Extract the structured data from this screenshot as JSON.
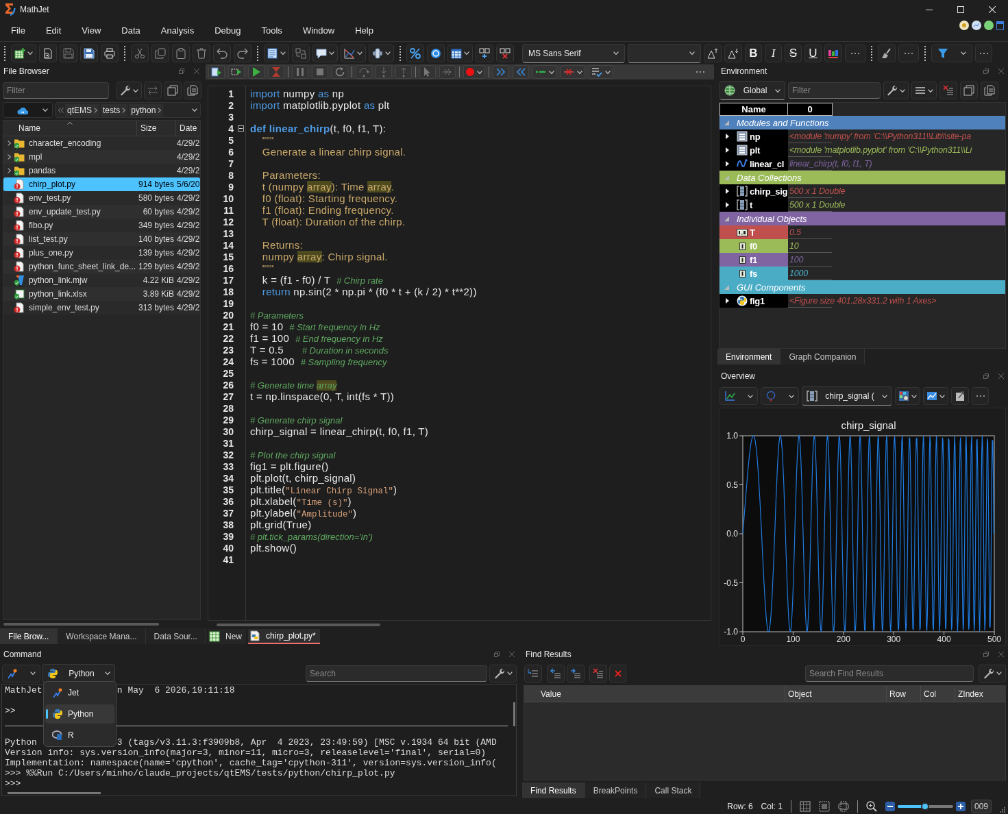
{
  "window": {
    "title": "MathJet"
  },
  "menu": [
    "File",
    "Edit",
    "View",
    "Data",
    "Analysis",
    "Debug",
    "Tools",
    "Window",
    "Help"
  ],
  "toolbar": {
    "font": "MS Sans Serif",
    "format_buttons": [
      {
        "label": "B",
        "kind": "bold"
      },
      {
        "label": "I",
        "kind": "italic"
      },
      {
        "label": "S",
        "kind": "strike"
      },
      {
        "label": "U",
        "kind": "underline"
      }
    ]
  },
  "file_browser": {
    "title": "File Browser",
    "filter": {
      "placeholder": "Filter"
    },
    "path": [
      "qtEMS",
      "tests",
      "python"
    ],
    "columns": [
      "Name",
      "Size",
      "Date"
    ],
    "files": [
      {
        "name": "character_encoding",
        "date": "4/29/2",
        "kind": "folder",
        "error": false,
        "selected": false
      },
      {
        "name": "mpl",
        "date": "4/29/2",
        "kind": "folder",
        "error": false,
        "selected": false
      },
      {
        "name": "pandas",
        "date": "4/29/2",
        "kind": "folder",
        "error": false,
        "selected": false
      },
      {
        "name": "chirp_plot.py",
        "size": "914 bytes",
        "date": "5/6/20",
        "kind": "python",
        "error": true,
        "selected": true
      },
      {
        "name": "env_test.py",
        "size": "580 bytes",
        "date": "4/29/2",
        "kind": "python",
        "error": true,
        "selected": false
      },
      {
        "name": "env_update_test.py",
        "size": "60 bytes",
        "date": "4/29/2",
        "kind": "python",
        "error": true,
        "selected": false
      },
      {
        "name": "fibo.py",
        "size": "349 bytes",
        "date": "4/29/2",
        "kind": "python",
        "error": true,
        "selected": false
      },
      {
        "name": "list_test.py",
        "size": "140 bytes",
        "date": "4/29/2",
        "kind": "python",
        "error": true,
        "selected": false
      },
      {
        "name": "plus_one.py",
        "size": "139 bytes",
        "date": "4/29/2",
        "kind": "python",
        "error": true,
        "selected": false
      },
      {
        "name": "python_func_sheet_link_de...",
        "size": "129 bytes",
        "date": "4/29/2",
        "kind": "python",
        "error": true,
        "selected": false
      },
      {
        "name": "python_link.mjw",
        "size": "4.22 KiB",
        "date": "4/29/2",
        "kind": "mathjet",
        "error": false,
        "selected": false
      },
      {
        "name": "python_link.xlsx",
        "size": "3.89 KiB",
        "date": "4/29/2",
        "kind": "excel",
        "error": false,
        "selected": false
      },
      {
        "name": "simple_env_test.py",
        "size": "313 bytes",
        "date": "4/29/2",
        "kind": "python",
        "error": true,
        "selected": false
      }
    ],
    "tabs": [
      {
        "label": "File Brow...",
        "selected": true
      },
      {
        "label": "Workspace Mana...",
        "selected": false
      },
      {
        "label": "Data Sour...",
        "selected": false
      }
    ]
  },
  "editor": {
    "lines": [
      {
        "number": "1",
        "fold": false,
        "segments": [
          {
            "kind": "keyword",
            "text": "import"
          },
          {
            "kind": "plain",
            "text": " numpy "
          },
          {
            "kind": "keyword",
            "text": "as"
          },
          {
            "kind": "plain",
            "text": " np"
          }
        ]
      },
      {
        "number": "2",
        "fold": false,
        "segments": [
          {
            "kind": "keyword",
            "text": "import"
          },
          {
            "kind": "plain",
            "text": " matplotlib.pyplot "
          },
          {
            "kind": "keyword",
            "text": "as"
          },
          {
            "kind": "plain",
            "text": " plt"
          }
        ]
      },
      {
        "number": "3",
        "fold": false
      },
      {
        "number": "4",
        "fold": true,
        "segments": [
          {
            "kind": "definition",
            "text": "def linear_chirp"
          },
          {
            "kind": "plain",
            "text": "(t, f0, f1, T):"
          }
        ]
      },
      {
        "number": "5",
        "fold": false,
        "segments": [
          {
            "kind": "docstring",
            "text": "    \"\"\""
          }
        ]
      },
      {
        "number": "6",
        "fold": false,
        "segments": [
          {
            "kind": "docstring",
            "text": "    Generate a linear chirp signal."
          }
        ]
      },
      {
        "number": "7",
        "fold": false
      },
      {
        "number": "8",
        "fold": false,
        "segments": [
          {
            "kind": "docstring",
            "text": "    Parameters:"
          }
        ]
      },
      {
        "number": "9",
        "fold": false,
        "segments": [
          {
            "kind": "docstring",
            "text": "    t (numpy "
          },
          {
            "kind": "docstring-match",
            "text": "array"
          },
          {
            "kind": "docstring",
            "text": "): Time "
          },
          {
            "kind": "docstring-match",
            "text": "array"
          },
          {
            "kind": "docstring",
            "text": "."
          }
        ]
      },
      {
        "number": "10",
        "fold": false,
        "segments": [
          {
            "kind": "docstring",
            "text": "    f0 (float): Starting frequency."
          }
        ]
      },
      {
        "number": "11",
        "fold": false,
        "segments": [
          {
            "kind": "docstring",
            "text": "    f1 (float): Ending frequency."
          }
        ]
      },
      {
        "number": "12",
        "fold": false,
        "segments": [
          {
            "kind": "docstring",
            "text": "    T (float): Duration of the chirp."
          }
        ]
      },
      {
        "number": "13",
        "fold": false
      },
      {
        "number": "14",
        "fold": false,
        "segments": [
          {
            "kind": "docstring",
            "text": "    Returns:"
          }
        ]
      },
      {
        "number": "15",
        "fold": false,
        "segments": [
          {
            "kind": "docstring",
            "text": "    numpy "
          },
          {
            "kind": "docstring-match",
            "text": "array"
          },
          {
            "kind": "docstring",
            "text": ": Chirp signal."
          }
        ]
      },
      {
        "number": "16",
        "fold": false,
        "segments": [
          {
            "kind": "docstring",
            "text": "    \"\"\""
          }
        ]
      },
      {
        "number": "17",
        "fold": false,
        "segments": [
          {
            "kind": "plain",
            "text": "    k = (f1 - f0) / T  "
          },
          {
            "kind": "comment",
            "text": "# Chirp rate"
          }
        ]
      },
      {
        "number": "18",
        "fold": false,
        "segments": [
          {
            "kind": "keyword",
            "text": "    return"
          },
          {
            "kind": "plain",
            "text": " np.sin(2 * np.pi * (f0 * t + (k / 2) * t**2))"
          }
        ]
      },
      {
        "number": "19",
        "fold": false
      },
      {
        "number": "20",
        "fold": false,
        "segments": [
          {
            "kind": "comment",
            "text": "# Parameters"
          }
        ]
      },
      {
        "number": "21",
        "fold": false,
        "segments": [
          {
            "kind": "plain",
            "text": "f0 = 10  "
          },
          {
            "kind": "comment",
            "text": "# Start frequency in Hz"
          }
        ]
      },
      {
        "number": "22",
        "fold": false,
        "segments": [
          {
            "kind": "plain",
            "text": "f1 = 100  "
          },
          {
            "kind": "comment",
            "text": "# End frequency in Hz"
          }
        ]
      },
      {
        "number": "23",
        "fold": false,
        "segments": [
          {
            "kind": "plain",
            "text": "T = 0.5      "
          },
          {
            "kind": "comment",
            "text": "# Duration in seconds"
          }
        ]
      },
      {
        "number": "24",
        "fold": false,
        "segments": [
          {
            "kind": "plain",
            "text": "fs = 1000  "
          },
          {
            "kind": "comment",
            "text": "# Sampling frequency"
          }
        ]
      },
      {
        "number": "25",
        "fold": false
      },
      {
        "number": "26",
        "fold": false,
        "segments": [
          {
            "kind": "comment",
            "text": "# Generate time "
          },
          {
            "kind": "comment-match",
            "text": "array"
          }
        ]
      },
      {
        "number": "27",
        "fold": false,
        "segments": [
          {
            "kind": "plain",
            "text": "t = np.linspace(0, T, int(fs * T))"
          }
        ]
      },
      {
        "number": "28",
        "fold": false
      },
      {
        "number": "29",
        "fold": false,
        "segments": [
          {
            "kind": "comment",
            "text": "# Generate chirp signal"
          }
        ]
      },
      {
        "number": "30",
        "fold": false,
        "segments": [
          {
            "kind": "plain",
            "text": "chirp_signal = linear_chirp(t, f0, f1, T)"
          }
        ]
      },
      {
        "number": "31",
        "fold": false
      },
      {
        "number": "32",
        "fold": false,
        "segments": [
          {
            "kind": "comment",
            "text": "# Plot the chirp signal"
          }
        ]
      },
      {
        "number": "33",
        "fold": false,
        "segments": [
          {
            "kind": "plain",
            "text": "fig1 = plt.figure()"
          }
        ]
      },
      {
        "number": "34",
        "fold": false,
        "segments": [
          {
            "kind": "plain",
            "text": "plt.plot(t, chirp_signal)"
          }
        ]
      },
      {
        "number": "35",
        "fold": false,
        "segments": [
          {
            "kind": "plain",
            "text": "plt.title("
          },
          {
            "kind": "string",
            "text": "\"Linear Chirp Signal\""
          },
          {
            "kind": "plain",
            "text": ")"
          }
        ]
      },
      {
        "number": "36",
        "fold": false,
        "segments": [
          {
            "kind": "plain",
            "text": "plt.xlabel("
          },
          {
            "kind": "string",
            "text": "\"Time (s)\""
          },
          {
            "kind": "plain",
            "text": ")"
          }
        ]
      },
      {
        "number": "37",
        "fold": false,
        "segments": [
          {
            "kind": "plain",
            "text": "plt.ylabel("
          },
          {
            "kind": "string",
            "text": "\"Amplitude\""
          },
          {
            "kind": "plain",
            "text": ")"
          }
        ]
      },
      {
        "number": "38",
        "fold": false,
        "segments": [
          {
            "kind": "plain",
            "text": "plt.grid(True)"
          }
        ]
      },
      {
        "number": "39",
        "fold": false,
        "segments": [
          {
            "kind": "comment",
            "text": "# plt.tick_params(direction='in')"
          }
        ]
      },
      {
        "number": "40",
        "fold": false,
        "segments": [
          {
            "kind": "plain",
            "text": "plt.show()"
          }
        ]
      },
      {
        "number": "41",
        "fold": false
      }
    ],
    "tabs": [
      {
        "label": "New",
        "kind": "sheet",
        "selected": false
      },
      {
        "label": "chirp_plot.py*",
        "kind": "python",
        "selected": true
      }
    ]
  },
  "environment": {
    "title": "Environment",
    "scope": "Global",
    "filter": {
      "placeholder": "Filter"
    },
    "columns": [
      "Name",
      "0"
    ],
    "groups": [
      {
        "label": "Modules and Functions",
        "color": "#4f81bd",
        "expanded": true,
        "items": [
          {
            "name": "np",
            "value": "<module 'numpy' from 'C:\\\\Python311\\\\Lib\\\\site-pa",
            "kind": "module",
            "color": "#c0504d",
            "highlighted": false,
            "expandable": true
          },
          {
            "name": "plt",
            "value": "<module 'matplotlib.pyplot' from 'C:\\\\Python311\\\\Li",
            "kind": "module",
            "color": "#9bbb59",
            "highlighted": false,
            "expandable": true
          },
          {
            "name": "linear_cl",
            "value": "linear_chirp(t, f0, f1, T)",
            "kind": "function",
            "color": "#8064a2",
            "highlighted": false,
            "expandable": true
          }
        ]
      },
      {
        "label": "Data Collections",
        "color": "#9bbb59",
        "expanded": true,
        "items": [
          {
            "name": "chirp_sig",
            "value": "500 x 1 Double",
            "kind": "array",
            "color": "#c0504d",
            "highlighted": false,
            "expandable": true
          },
          {
            "name": "t",
            "value": "500 x 1 Double",
            "kind": "array",
            "color": "#9bbb59",
            "highlighted": false,
            "expandable": true
          }
        ]
      },
      {
        "label": "Individual Objects",
        "color": "#8064a2",
        "expanded": true,
        "items": [
          {
            "name": "T",
            "value": "0.5",
            "kind": "double",
            "color": "#c0504d",
            "highlighted": true,
            "expandable": false
          },
          {
            "name": "f0",
            "value": "10",
            "kind": "integer",
            "color": "#9bbb59",
            "highlighted": true,
            "expandable": false
          },
          {
            "name": "f1",
            "value": "100",
            "kind": "integer",
            "color": "#8064a2",
            "highlighted": true,
            "expandable": false
          },
          {
            "name": "fs",
            "value": "1000",
            "kind": "integer",
            "color": "#4bacc6",
            "highlighted": true,
            "expandable": false
          }
        ]
      },
      {
        "label": "GUI Components",
        "color": "#4bacc6",
        "expanded": true,
        "items": [
          {
            "name": "fig1",
            "value": "<Figure size 401.28x331.2 with 1 Axes>",
            "kind": "figure",
            "color": "#c0504d",
            "highlighted": false,
            "expandable": true
          }
        ]
      }
    ],
    "tabs": [
      {
        "label": "Environment",
        "selected": true
      },
      {
        "label": "Graph Companion",
        "selected": false
      }
    ]
  },
  "overview": {
    "title": "Overview",
    "series": "chirp_signal (",
    "chart": {
      "title": "chirp_signal",
      "y_tick_labels": [
        "1.0",
        "0.5",
        "0.0",
        "-0.5",
        "-1.0"
      ],
      "x_tick_labels": [
        "0",
        "100",
        "200",
        "300",
        "400",
        "500"
      ]
    }
  },
  "command": {
    "title": "Command",
    "search": {
      "placeholder": "Search"
    },
    "language": {
      "value": "Python",
      "open": true,
      "options": [
        {
          "label": "Jet",
          "kind": "jet",
          "selected": false
        },
        {
          "label": "Python",
          "kind": "python",
          "selected": true
        },
        {
          "label": "R",
          "kind": "r",
          "selected": false
        }
      ]
    },
    "console": [
      {
        "kind": "text",
        "parts": [
          "MathJet",
          "n May  6 2026,19:11:18"
        ]
      },
      {
        "kind": "text",
        "parts": [
          ">>"
        ]
      },
      {
        "kind": "rule"
      },
      {
        "kind": "text",
        "parts": [
          "Python",
          "3 (tags/v3.11.3:f3909b8, Apr  4 2023, 23:49:59) [MSC v.1934 64 bit (AMD"
        ]
      },
      {
        "kind": "text",
        "parts": [
          "Version info: sys.version_info(major=3, minor=11, micro=3, releaselevel='final', serial=0)"
        ]
      },
      {
        "kind": "text",
        "parts": [
          "Implementation: namespace(name='cpython', cache_tag='cpython-311', version=sys.version_info("
        ]
      },
      {
        "kind": "text",
        "parts": [
          ">>> %%Run C:/Users/minho/claude_projects/qtEMS/tests/python/chirp_plot.py"
        ]
      },
      {
        "kind": "text",
        "parts": [
          ">>>"
        ]
      }
    ]
  },
  "find_results": {
    "title": "Find Results",
    "search": {
      "placeholder": "Search Find Results"
    },
    "columns": [
      "Value",
      "Object",
      "Row",
      "Col",
      "ZIndex"
    ],
    "tabs": [
      {
        "label": "Find Results",
        "selected": true
      },
      {
        "label": "BreakPoints",
        "selected": false
      },
      {
        "label": "Call Stack",
        "selected": false
      }
    ]
  },
  "status_bar": {
    "row": "Row: 6",
    "col": "Col: 1",
    "zoom": {
      "level": 0.5,
      "value": "009"
    }
  }
}
